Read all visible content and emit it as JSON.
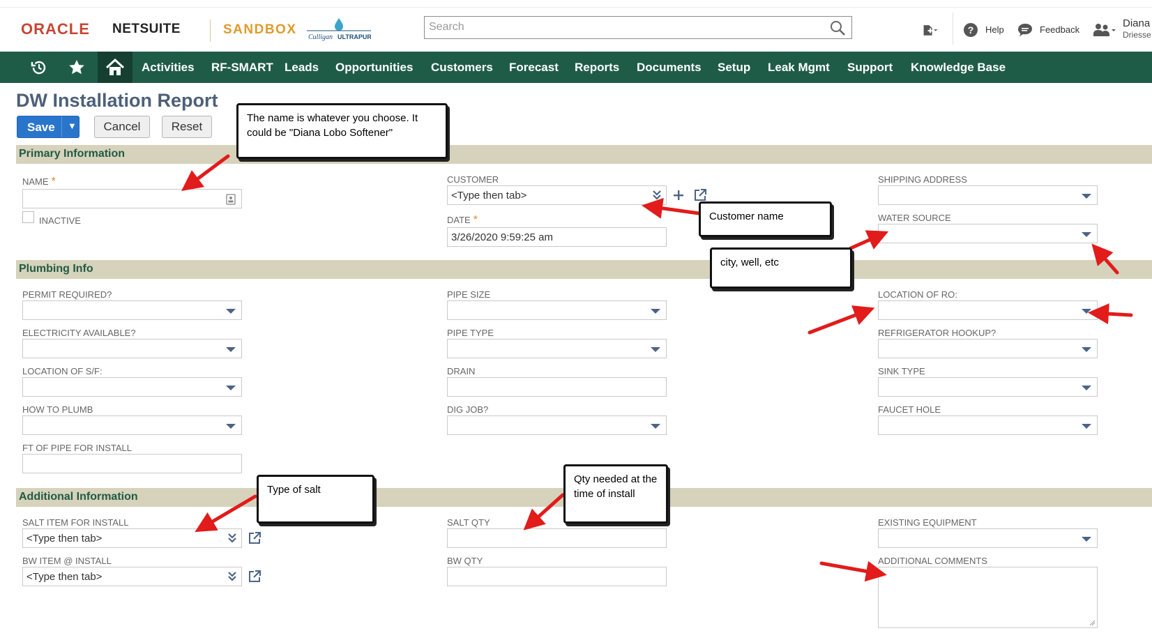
{
  "header": {
    "logo_oracle": "ORACLE",
    "logo_netsuite": "NETSUITE",
    "logo_sandbox": "SANDBOX",
    "logo_culligan": "Culligan ULTRAPURE",
    "search_placeholder": "Search",
    "help_label": "Help",
    "feedback_label": "Feedback",
    "user_name": "Diana",
    "user_sub": "Driesse"
  },
  "nav": {
    "items": [
      "Activities",
      "RF-SMART",
      "Leads",
      "Opportunities",
      "Customers",
      "Forecast",
      "Reports",
      "Documents",
      "Setup",
      "Leak Mgmt",
      "Support",
      "Knowledge Base"
    ]
  },
  "page": {
    "title": "DW Installation Report",
    "save_label": "Save",
    "cancel_label": "Cancel",
    "reset_label": "Reset"
  },
  "sections": {
    "primary": "Primary Information",
    "plumbing": "Plumbing Info",
    "additional": "Additional Information"
  },
  "fields": {
    "name": "NAME",
    "inactive": "INACTIVE",
    "customer": "CUSTOMER",
    "customer_value": "<Type then tab>",
    "date": "DATE",
    "date_value": "3/26/2020 9:59:25 am",
    "shipping_address": "SHIPPING ADDRESS",
    "water_source": "WATER SOURCE",
    "permit_required": "PERMIT REQUIRED?",
    "electricity_available": "ELECTRICITY AVAILABLE?",
    "location_sf": "LOCATION OF S/F:",
    "how_to_plumb": "HOW TO PLUMB",
    "ft_of_pipe": "FT OF PIPE FOR INSTALL",
    "pipe_size": "PIPE SIZE",
    "pipe_type": "PIPE TYPE",
    "drain": "DRAIN",
    "dig_job": "DIG JOB?",
    "location_ro": "LOCATION OF RO:",
    "refrigerator_hookup": "REFRIGERATOR HOOKUP?",
    "sink_type": "SINK TYPE",
    "faucet_hole": "FAUCET HOLE",
    "salt_item": "SALT ITEM FOR INSTALL",
    "salt_item_value": "<Type then tab>",
    "bw_item": "BW ITEM @ INSTALL",
    "bw_item_value": "<Type then tab>",
    "salt_qty": "SALT QTY",
    "bw_qty": "BW QTY",
    "existing_equipment": "EXISTING EQUIPMENT",
    "additional_comments": "ADDITIONAL COMMENTS"
  },
  "callouts": {
    "name_note": "The name is whatever you choose. It could be \"Diana Lobo Softener\"",
    "customer_note": "Customer name",
    "water_note": "city, well, etc",
    "salt_note": "Type of salt",
    "qty_note": "Qty needed at the time of install"
  },
  "colors": {
    "nav_bg": "#1f5c48",
    "section_bg": "#d6d2bb",
    "save_blue": "#2a75cc",
    "arrow_red": "#e21b1b"
  }
}
